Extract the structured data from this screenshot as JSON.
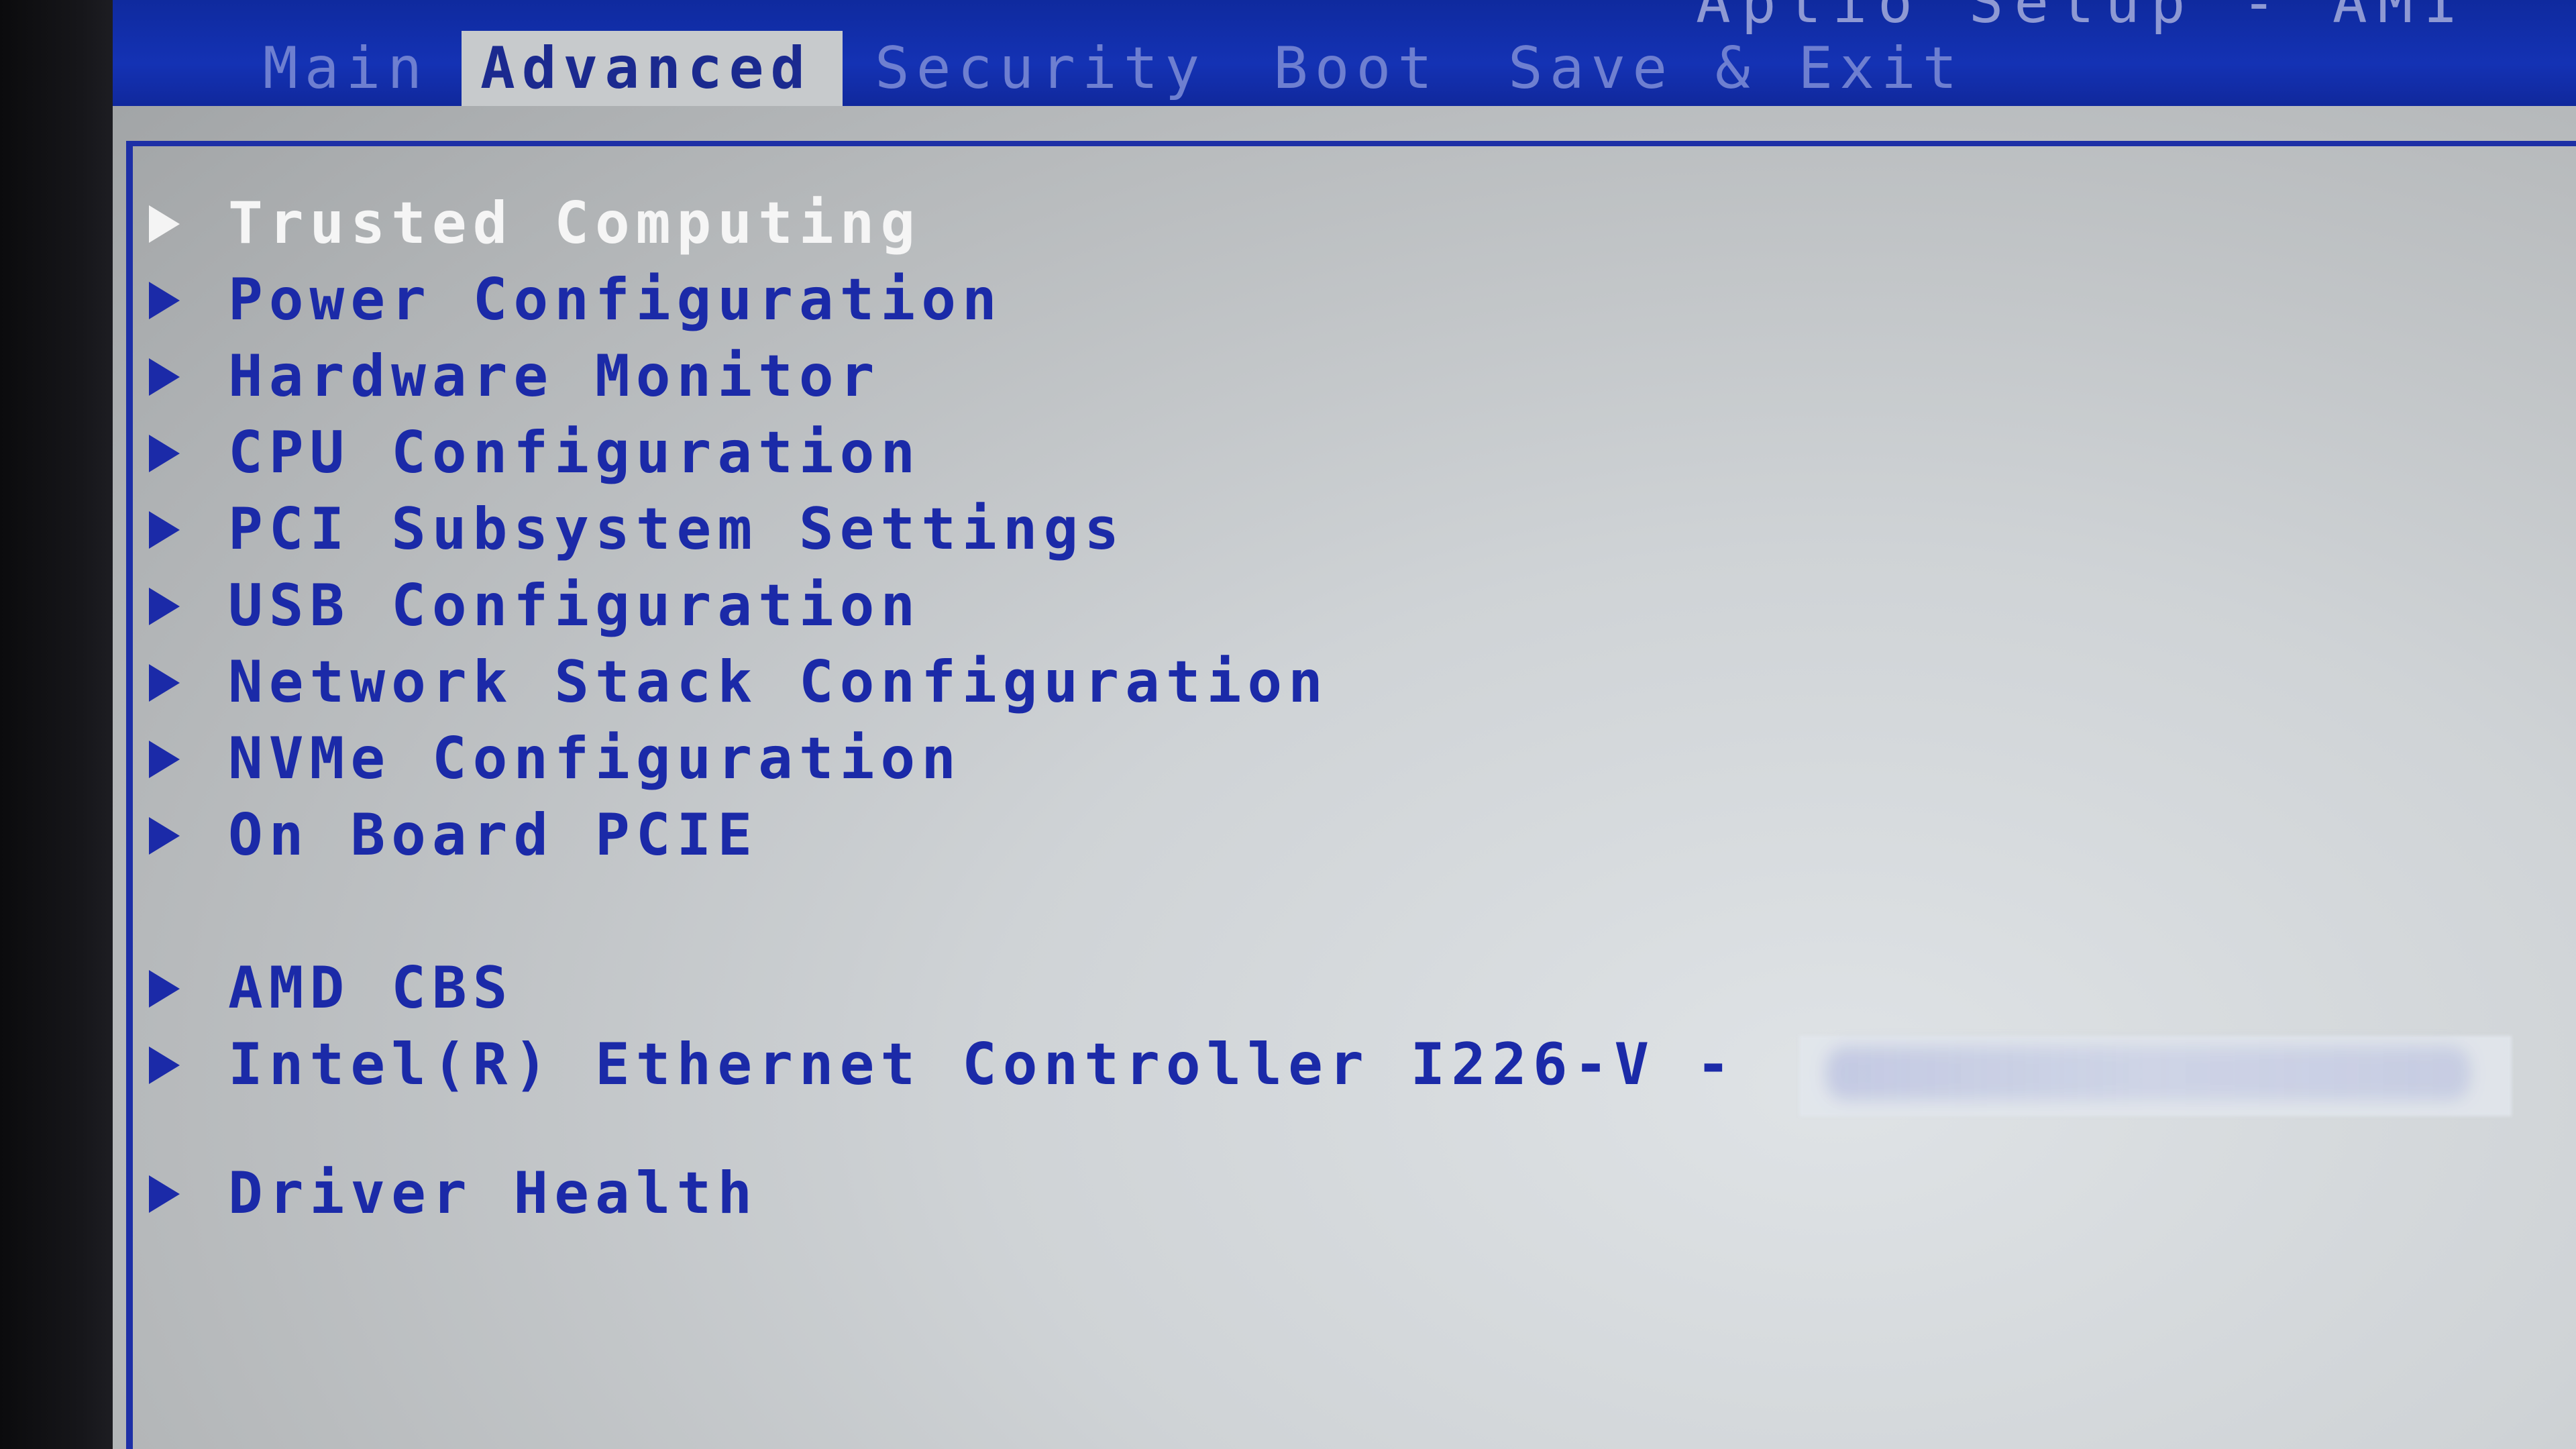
{
  "header": {
    "title": "Aptio Setup - AMI",
    "tabs": [
      {
        "label": "Main"
      },
      {
        "label": "Advanced"
      },
      {
        "label": "Security"
      },
      {
        "label": "Boot"
      },
      {
        "label": "Save & Exit"
      }
    ],
    "active_tab": "Advanced"
  },
  "menu": {
    "items": [
      {
        "label": "Trusted Computing",
        "icon": "submenu-arrow",
        "selected": true
      },
      {
        "label": "Power Configuration",
        "icon": "submenu-arrow"
      },
      {
        "label": "Hardware Monitor",
        "icon": "submenu-arrow"
      },
      {
        "label": "CPU Configuration",
        "icon": "submenu-arrow"
      },
      {
        "label": "PCI Subsystem Settings",
        "icon": "submenu-arrow"
      },
      {
        "label": "USB Configuration",
        "icon": "submenu-arrow"
      },
      {
        "label": "Network Stack Configuration",
        "icon": "submenu-arrow"
      },
      {
        "label": "NVMe Configuration",
        "icon": "submenu-arrow"
      },
      {
        "label": "On Board PCIE",
        "icon": "submenu-arrow"
      },
      {
        "label": "AMD CBS",
        "icon": "submenu-arrow"
      },
      {
        "label": "Intel(R) Ethernet Controller I226-V -",
        "icon": "submenu-arrow",
        "mac_address_redacted": true
      },
      {
        "label": "Driver Health",
        "icon": "submenu-arrow"
      }
    ]
  },
  "colors": {
    "header_bg": "#1432b4",
    "menu_text": "#1b2aa8",
    "selected_text": "#f5f5f5",
    "panel_bg": "#cfd3d6",
    "active_tab_bg": "#c7cacc"
  }
}
